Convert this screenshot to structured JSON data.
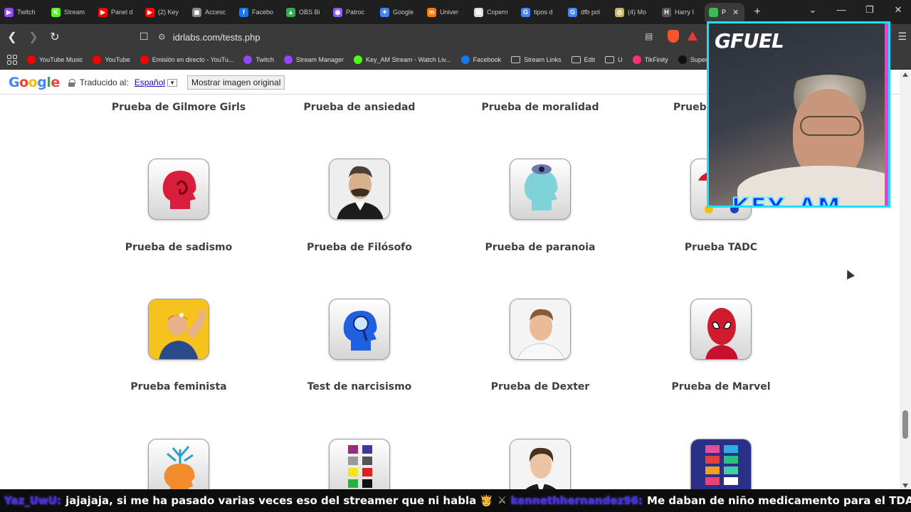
{
  "tabs": [
    {
      "label": "Twitch",
      "color": "#9146ff",
      "glyph": "▶"
    },
    {
      "label": "Stream",
      "color": "#53fc18",
      "glyph": "K"
    },
    {
      "label": "Panel d",
      "color": "#ff0000",
      "glyph": "▶"
    },
    {
      "label": "(2) Key",
      "color": "#ff0000",
      "glyph": "▶"
    },
    {
      "label": "Accesc",
      "color": "#888888",
      "glyph": "◼"
    },
    {
      "label": "Facebo",
      "color": "#1877f2",
      "glyph": "f"
    },
    {
      "label": "OBS Bi",
      "color": "#34a853",
      "glyph": "▲"
    },
    {
      "label": "Patroc",
      "color": "#8b5cf6",
      "glyph": "◉"
    },
    {
      "label": "Google",
      "color": "#4285f4",
      "glyph": "✦"
    },
    {
      "label": "Univer",
      "color": "#ff7a00",
      "glyph": "m"
    },
    {
      "label": "Copern",
      "color": "#dddddd",
      "glyph": "⊠"
    },
    {
      "label": "tipos d",
      "color": "#4285f4",
      "glyph": "G"
    },
    {
      "label": "dfb pol",
      "color": "#4285f4",
      "glyph": "G"
    },
    {
      "label": "(4) Mo",
      "color": "#c8b46a",
      "glyph": "◎"
    },
    {
      "label": "Harry I",
      "color": "#555555",
      "glyph": "H"
    }
  ],
  "active_tab": {
    "label": "P",
    "color": "#3cba54"
  },
  "address": {
    "url": "idrlabs.com/tests.php"
  },
  "bookmarks": [
    {
      "label": "YouTube Music",
      "color": "#ff0000"
    },
    {
      "label": "YouTube",
      "color": "#ff0000"
    },
    {
      "label": "Emisión en directo - YouTu...",
      "color": "#ff0000"
    },
    {
      "label": "Twitch",
      "color": "#9146ff"
    },
    {
      "label": "Stream Manager",
      "color": "#9146ff"
    },
    {
      "label": "Key_AM Stream - Watch Liv...",
      "color": "#53fc18"
    },
    {
      "label": "Facebook",
      "color": "#1877f2"
    },
    {
      "label": "Stream Links",
      "folder": true
    },
    {
      "label": "Edit",
      "folder": true
    },
    {
      "label": "U",
      "folder": true
    },
    {
      "label": "TikFinity",
      "color": "#ff3366"
    },
    {
      "label": "Supervisión del LI",
      "color": "#111111"
    }
  ],
  "translate": {
    "logo": "Google",
    "label": "Traducido al:",
    "language": "Español",
    "dropdown": "▼",
    "show_original": "Mostrar imagen original"
  },
  "tests": [
    {
      "title": "Prueba de Gilmore Girls",
      "icon": "gilmore-girls-icon",
      "row": 0,
      "col": 0
    },
    {
      "title": "Prueba de ansiedad",
      "icon": "anxiety-icon",
      "row": 0,
      "col": 1
    },
    {
      "title": "Prueba de moralidad",
      "icon": "morality-icon",
      "row": 0,
      "col": 2
    },
    {
      "title": "Prueb",
      "icon": "partial-test-icon",
      "row": 0,
      "col": 3
    },
    {
      "title": "Prueba de sadismo",
      "icon": "sadism-head-icon",
      "row": 1,
      "col": 0
    },
    {
      "title": "Prueba de Filósofo",
      "icon": "philosopher-portrait-icon",
      "row": 1,
      "col": 1
    },
    {
      "title": "Prueba de paranoia",
      "icon": "paranoia-eye-head-icon",
      "row": 1,
      "col": 2
    },
    {
      "title": "Prueba TADC",
      "icon": "tadc-jester-icon",
      "row": 1,
      "col": 3
    },
    {
      "title": "Prueba feminista",
      "icon": "rosie-riveter-icon",
      "row": 2,
      "col": 0
    },
    {
      "title": "Test de narcisismo",
      "icon": "narcissism-mirror-head-icon",
      "row": 2,
      "col": 1
    },
    {
      "title": "Prueba de Dexter",
      "icon": "dexter-portrait-icon",
      "row": 2,
      "col": 2
    },
    {
      "title": "Prueba de Marvel",
      "icon": "spiderman-mask-icon",
      "row": 2,
      "col": 3
    },
    {
      "title": "",
      "icon": "brain-tree-head-icon",
      "row": 3,
      "col": 0
    },
    {
      "title": "",
      "icon": "color-swatches-icon",
      "row": 3,
      "col": 1
    },
    {
      "title": "",
      "icon": "businessman-portrait-icon",
      "row": 3,
      "col": 2
    },
    {
      "title": "",
      "icon": "color-grid-icon",
      "row": 3,
      "col": 3
    }
  ],
  "overlay": {
    "brand": "GFUEL",
    "name": "KEY_AM"
  },
  "chat": [
    {
      "user": "Yaz_UwU:",
      "message": "jajajaja, si me ha pasado varias veces eso del streamer que ni habla 🫅"
    },
    {
      "user": "kennethhernandez96:",
      "message": "Me daban de niño medicamento para el TDAH"
    }
  ],
  "chat_separator": "⚔",
  "colors": {
    "overlay_border": "#19e0ff",
    "overlay_name": "#1f2cff",
    "link": "#1a0dab"
  }
}
